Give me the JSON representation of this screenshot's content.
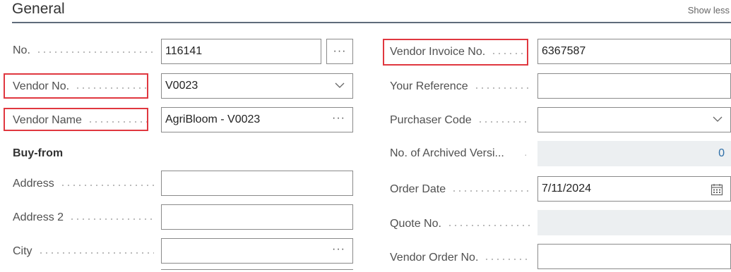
{
  "header": {
    "title": "General",
    "show_less": "Show less"
  },
  "left": {
    "no_label": "No.",
    "no_value": "116141",
    "no_more": "···",
    "vendor_no_label": "Vendor No.",
    "vendor_no_value": "V0023",
    "vendor_name_label": "Vendor Name",
    "vendor_name_value": "AgriBloom - V0023",
    "vendor_name_more": "···",
    "buy_from_heading": "Buy-from",
    "address_label": "Address",
    "address_value": "",
    "address2_label": "Address 2",
    "address2_value": "",
    "city_label": "City",
    "city_value": "",
    "city_more": "···"
  },
  "right": {
    "vendor_invoice_no_label": "Vendor Invoice No.",
    "vendor_invoice_no_value": "6367587",
    "your_reference_label": "Your Reference",
    "your_reference_value": "",
    "purchaser_code_label": "Purchaser Code",
    "purchaser_code_value": "",
    "archived_versions_label": "No. of Archived Versi...",
    "archived_versions_value": "0",
    "order_date_label": "Order Date",
    "order_date_value": "7/11/2024",
    "quote_no_label": "Quote No.",
    "quote_no_value": "",
    "vendor_order_no_label": "Vendor Order No.",
    "vendor_order_no_value": ""
  },
  "colors": {
    "highlight": "#e0373f",
    "link_value": "#2e6fa8",
    "readonly_bg": "#eceff1"
  }
}
